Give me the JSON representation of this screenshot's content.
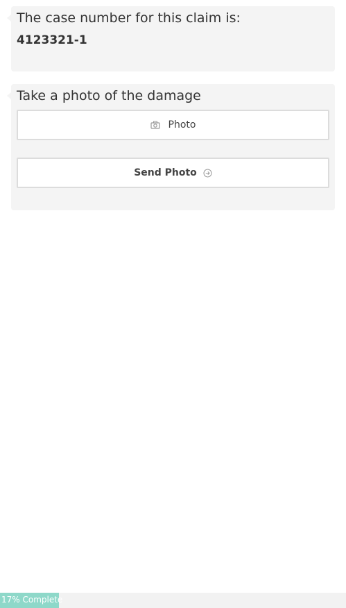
{
  "case_card": {
    "label": "The case number for this claim is:",
    "case_number": "4123321-1"
  },
  "photo_card": {
    "prompt": "Take a photo of the damage",
    "photo_button_label": "Photo",
    "photo_button_icon": "camera-icon",
    "send_button_label": "Send Photo",
    "send_button_icon": "arrow-circle-right-icon"
  },
  "progress": {
    "fraction": 0.17,
    "label": "17% Complete",
    "color": "#8ed8c9"
  }
}
